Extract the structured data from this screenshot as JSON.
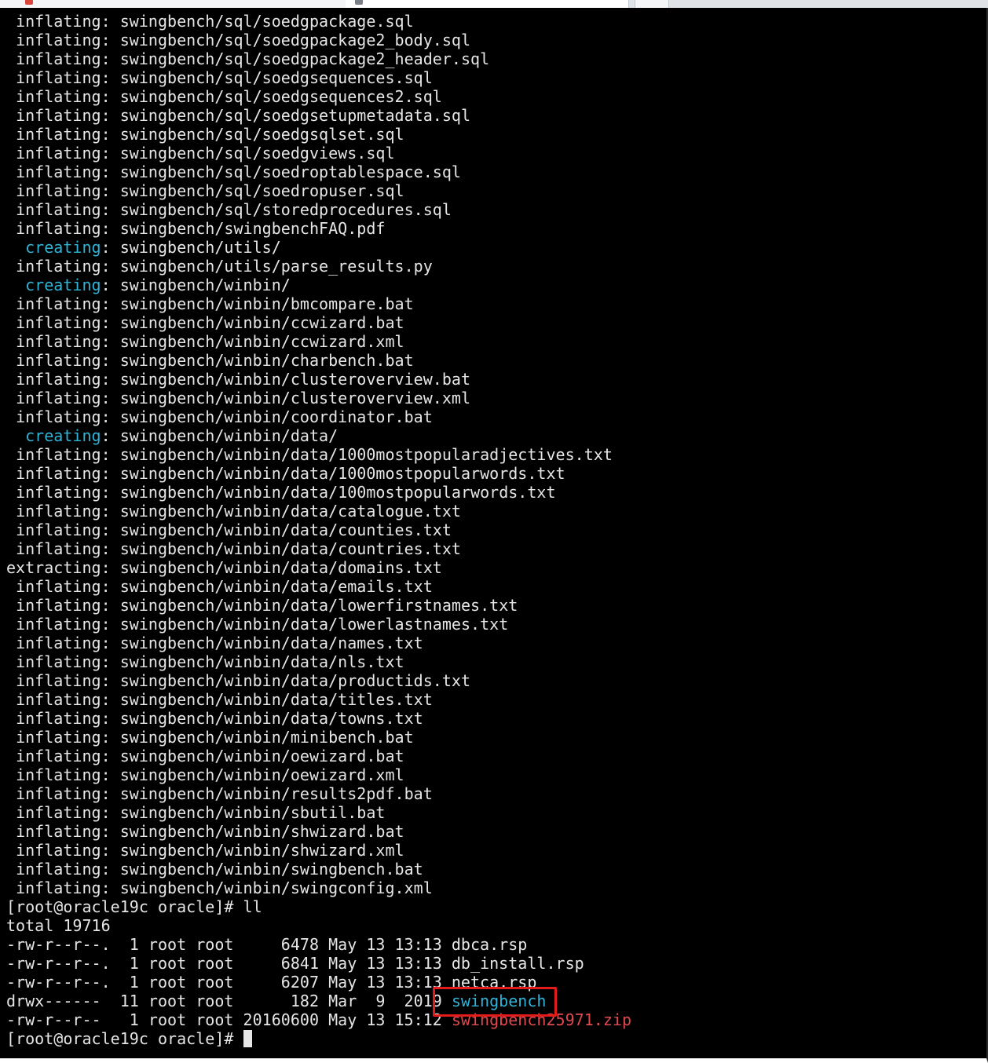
{
  "terminal": {
    "lines": [
      {
        "action": "inflating",
        "path": "swingbench/sql/soedgpackage.sql"
      },
      {
        "action": "inflating",
        "path": "swingbench/sql/soedgpackage2_body.sql"
      },
      {
        "action": "inflating",
        "path": "swingbench/sql/soedgpackage2_header.sql"
      },
      {
        "action": "inflating",
        "path": "swingbench/sql/soedgsequences.sql"
      },
      {
        "action": "inflating",
        "path": "swingbench/sql/soedgsequences2.sql"
      },
      {
        "action": "inflating",
        "path": "swingbench/sql/soedgsetupmetadata.sql"
      },
      {
        "action": "inflating",
        "path": "swingbench/sql/soedgsqlset.sql"
      },
      {
        "action": "inflating",
        "path": "swingbench/sql/soedgviews.sql"
      },
      {
        "action": "inflating",
        "path": "swingbench/sql/soedroptablespace.sql"
      },
      {
        "action": "inflating",
        "path": "swingbench/sql/soedropuser.sql"
      },
      {
        "action": "inflating",
        "path": "swingbench/sql/storedprocedures.sql"
      },
      {
        "action": "inflating",
        "path": "swingbench/swingbenchFAQ.pdf"
      },
      {
        "action": "creating",
        "path": "swingbench/utils/"
      },
      {
        "action": "inflating",
        "path": "swingbench/utils/parse_results.py"
      },
      {
        "action": "creating",
        "path": "swingbench/winbin/"
      },
      {
        "action": "inflating",
        "path": "swingbench/winbin/bmcompare.bat"
      },
      {
        "action": "inflating",
        "path": "swingbench/winbin/ccwizard.bat"
      },
      {
        "action": "inflating",
        "path": "swingbench/winbin/ccwizard.xml"
      },
      {
        "action": "inflating",
        "path": "swingbench/winbin/charbench.bat"
      },
      {
        "action": "inflating",
        "path": "swingbench/winbin/clusteroverview.bat"
      },
      {
        "action": "inflating",
        "path": "swingbench/winbin/clusteroverview.xml"
      },
      {
        "action": "inflating",
        "path": "swingbench/winbin/coordinator.bat"
      },
      {
        "action": "creating",
        "path": "swingbench/winbin/data/"
      },
      {
        "action": "inflating",
        "path": "swingbench/winbin/data/1000mostpopularadjectives.txt"
      },
      {
        "action": "inflating",
        "path": "swingbench/winbin/data/1000mostpopularwords.txt"
      },
      {
        "action": "inflating",
        "path": "swingbench/winbin/data/100mostpopularwords.txt"
      },
      {
        "action": "inflating",
        "path": "swingbench/winbin/data/catalogue.txt"
      },
      {
        "action": "inflating",
        "path": "swingbench/winbin/data/counties.txt"
      },
      {
        "action": "inflating",
        "path": "swingbench/winbin/data/countries.txt"
      },
      {
        "action": "extracting",
        "path": "swingbench/winbin/data/domains.txt"
      },
      {
        "action": "inflating",
        "path": "swingbench/winbin/data/emails.txt"
      },
      {
        "action": "inflating",
        "path": "swingbench/winbin/data/lowerfirstnames.txt"
      },
      {
        "action": "inflating",
        "path": "swingbench/winbin/data/lowerlastnames.txt"
      },
      {
        "action": "inflating",
        "path": "swingbench/winbin/data/names.txt"
      },
      {
        "action": "inflating",
        "path": "swingbench/winbin/data/nls.txt"
      },
      {
        "action": "inflating",
        "path": "swingbench/winbin/data/productids.txt"
      },
      {
        "action": "inflating",
        "path": "swingbench/winbin/data/titles.txt"
      },
      {
        "action": "inflating",
        "path": "swingbench/winbin/data/towns.txt"
      },
      {
        "action": "inflating",
        "path": "swingbench/winbin/minibench.bat"
      },
      {
        "action": "inflating",
        "path": "swingbench/winbin/oewizard.bat"
      },
      {
        "action": "inflating",
        "path": "swingbench/winbin/oewizard.xml"
      },
      {
        "action": "inflating",
        "path": "swingbench/winbin/results2pdf.bat"
      },
      {
        "action": "inflating",
        "path": "swingbench/winbin/sbutil.bat"
      },
      {
        "action": "inflating",
        "path": "swingbench/winbin/shwizard.bat"
      },
      {
        "action": "inflating",
        "path": "swingbench/winbin/shwizard.xml"
      },
      {
        "action": "inflating",
        "path": "swingbench/winbin/swingbench.bat"
      },
      {
        "action": "inflating",
        "path": "swingbench/winbin/swingconfig.xml"
      }
    ],
    "prompt": "[root@oracle19c oracle]# ",
    "command": "ll",
    "total": "total 19716",
    "listing": [
      {
        "perms": "-rw-r--r--.",
        "links": "1",
        "owner": "root",
        "group": "root",
        "size": "6478",
        "month": "May",
        "day": "13",
        "time": "13:13",
        "name": "dbca.rsp",
        "color": "#e6e6e6"
      },
      {
        "perms": "-rw-r--r--.",
        "links": "1",
        "owner": "root",
        "group": "root",
        "size": "6841",
        "month": "May",
        "day": "13",
        "time": "13:13",
        "name": "db_install.rsp",
        "color": "#e6e6e6"
      },
      {
        "perms": "-rw-r--r--.",
        "links": "1",
        "owner": "root",
        "group": "root",
        "size": "6207",
        "month": "May",
        "day": "13",
        "time": "13:13",
        "name": "netca.rsp",
        "color": "#e6e6e6"
      },
      {
        "perms": "drwx------",
        "links": "11",
        "owner": "root",
        "group": "root",
        "size": "182",
        "month": "Mar",
        "day": "9",
        "time": "2019",
        "name": "swingbench",
        "color": "#2fb3d6"
      },
      {
        "perms": "-rw-r--r--",
        "links": "1",
        "owner": "root",
        "group": "root",
        "size": "20160600",
        "month": "May",
        "day": "13",
        "time": "15:12",
        "name": "swingbench25971.zip",
        "color": "#e0494f"
      }
    ],
    "colors": {
      "background": "#000000",
      "text": "#e6e6e6",
      "directory": "#2fb3d6",
      "archive": "#e0494f",
      "highlight_box": "#e31b1b"
    }
  }
}
